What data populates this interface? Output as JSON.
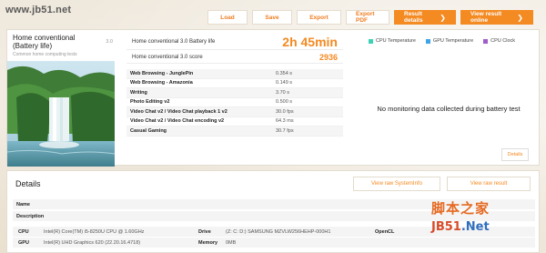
{
  "watermark_top": "www.jb51.net",
  "toolbar": {
    "load": "Load",
    "save": "Save",
    "export": "Export",
    "export_pdf": "Export PDF",
    "result_details": "Result details",
    "view_result_online": "View result online",
    "chevron": "❯"
  },
  "test": {
    "title": "Home conventional (Battery life)",
    "version": "3.0",
    "subtitle": "Common home computing tests"
  },
  "battery": {
    "label": "Home conventional 3.0 Battery life",
    "value": "2h 45min"
  },
  "score": {
    "label": "Home conventional 3.0 score",
    "value": "2936"
  },
  "subtests": [
    {
      "name": "Web Browsing - JunglePin",
      "value": "0.354 s"
    },
    {
      "name": "Web Browsing - Amazonia",
      "value": "0.149 s"
    },
    {
      "name": "Writing",
      "value": "3.70 s"
    },
    {
      "name": "Photo Editing v2",
      "value": "0.500 s"
    },
    {
      "name": "Video Chat v2 / Video Chat playback 1 v2",
      "value": "30.0 fps"
    },
    {
      "name": "Video Chat v2 / Video Chat encoding v2",
      "value": "64.3 ms"
    },
    {
      "name": "Casual Gaming",
      "value": "30.7 fps"
    }
  ],
  "monitor": {
    "legend": [
      {
        "label": "CPU Temperature",
        "color": "#3fd1b5"
      },
      {
        "label": "GPU Temperature",
        "color": "#3ea3e8"
      },
      {
        "label": "CPU Clock",
        "color": "#a05cc8"
      }
    ],
    "no_data": "No monitoring data collected during battery test",
    "details_button": "Details"
  },
  "details": {
    "title": "Details",
    "view_sysinfo": "View raw SystemInfo",
    "view_result": "View raw result",
    "name_label": "Name",
    "name_value": "",
    "description_label": "Description",
    "description_value": "",
    "cpu_label": "CPU",
    "cpu_value": "Intel(R) Core(TM) i5-8250U CPU @ 1.60GHz",
    "gpu_label": "GPU",
    "gpu_value": "Intel(R) UHD Graphics 620 (22.20.16.4718)",
    "drive_label": "Drive",
    "drive_value": "(Z: C: D:) SAMSUNG MZVLW256HEHP-000H1",
    "memory_label": "Memory",
    "memory_value": "0MB",
    "opencl_label": "OpenCL",
    "opencl_value": ""
  },
  "watermark_br": {
    "cn": "脚本之家",
    "en_a": "JB51",
    "en_b": ".Net"
  },
  "colors": {
    "accent": "#f48a22",
    "title_text": "#222222"
  }
}
